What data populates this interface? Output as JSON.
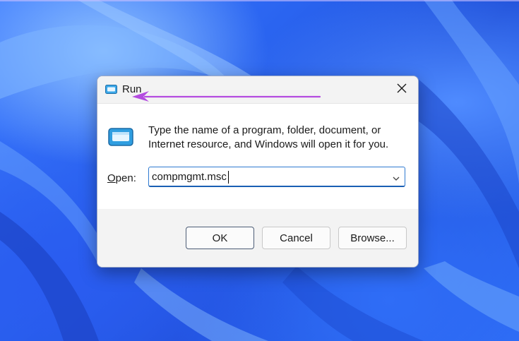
{
  "dialog": {
    "title": "Run",
    "description": "Type the name of a program, folder, document, or Internet resource, and Windows will open it for you.",
    "open_label_accel": "O",
    "open_label_rest": "pen:",
    "open_value": "compmgmt.msc",
    "buttons": {
      "ok": "OK",
      "cancel": "Cancel",
      "browse": "Browse..."
    }
  },
  "colors": {
    "accent": "#2e7ad1",
    "annotation_arrow": "#b44ce0",
    "wallpaper": "#2a64f0"
  },
  "icons": [
    "run-app-icon",
    "close-icon",
    "chevron-down-icon",
    "annotation-arrow-icon"
  ]
}
